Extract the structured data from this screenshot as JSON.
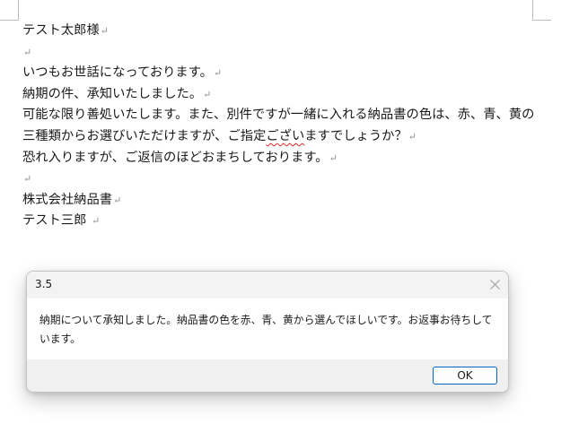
{
  "document": {
    "paragraph_mark": "↵",
    "lines": [
      {
        "text": "テスト太郎様"
      },
      {
        "text": ""
      },
      {
        "text": "いつもお世話になっております。"
      },
      {
        "text": "納期の件、承知いたしました。"
      },
      {
        "before": "可能な限り善処いたします。また、別件ですが一緒に入れる納品書の色は、赤、青、黄の三種類からお選びいただけますが、ご指定",
        "flagged": "ござい",
        "after": "ますでしょうか？"
      },
      {
        "text": "恐れ入りますが、ご返信のほどおまちしております。"
      },
      {
        "text": ""
      },
      {
        "text": "株式会社納品書"
      },
      {
        "text": "テスト三郎 "
      }
    ]
  },
  "dialog": {
    "title": "3.5",
    "message": "納期について承知しました。納品書の色を赤、青、黄から選んでほしいです。お返事お待ちしています。",
    "ok_label": "OK",
    "close_icon": "close-x"
  }
}
